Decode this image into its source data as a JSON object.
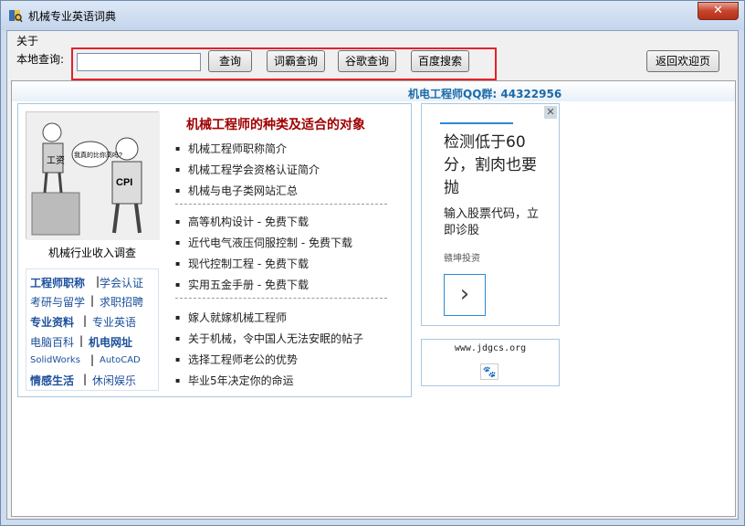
{
  "window": {
    "title": "机械专业英语词典",
    "close_label": "✕"
  },
  "menu": {
    "about": "关于"
  },
  "toolbar": {
    "search_label": "本地查询:",
    "search_value": "",
    "buttons": [
      "查询",
      "词霸查询",
      "谷歌查询",
      "百度搜索"
    ],
    "home_button": "返回欢迎页"
  },
  "page": {
    "qq_group": "机电工程师QQ群: 44322956",
    "cartoon_texts": {
      "bubble": "我真的比你高吗?",
      "left_label": "工资",
      "right_label": "CPI"
    },
    "cartoon_caption": "机械行业收入调查",
    "article_title": "机械工程师的种类及适合的对象",
    "articles_group1": [
      "机械工程师职称简介",
      "机械工程学会资格认证简介",
      "机械与电子类网站汇总"
    ],
    "articles_group2": [
      "高等机构设计 - 免费下载",
      "近代电气液压伺服控制 - 免费下载",
      "现代控制工程 - 免费下载",
      "实用五金手册 - 免费下载"
    ],
    "articles_group3": [
      "嫁人就嫁机械工程师",
      "关于机械，令中国人无法安眠的帖子",
      "选择工程师老公的优势",
      "毕业5年决定你的命运"
    ],
    "links": {
      "row1_a": "工程师职称",
      "row1_b": "学会认证",
      "row2_a": "考研与留学",
      "row2_b": "求职招聘",
      "row3_a": "专业资料",
      "row3_b": "专业英语",
      "row4_a": "电脑百科",
      "row4_b": "机电网址",
      "row5_a": "SolidWorks",
      "row5_b": "AutoCAD",
      "row6_a": "情感生活",
      "row6_b": "休闲娱乐"
    },
    "ad": {
      "close": "✕",
      "headline": "检测低于60分，割肉也要抛",
      "sub": "输入股票代码，立即诊股",
      "small": "赣坤投资",
      "arrow": "›"
    },
    "logo_url": "www.jdgcs.org",
    "logo_paw": "🐾"
  },
  "colors": {
    "accent": "#1b6aa8",
    "title_red": "#a00000",
    "highlight": "#e2222a"
  }
}
